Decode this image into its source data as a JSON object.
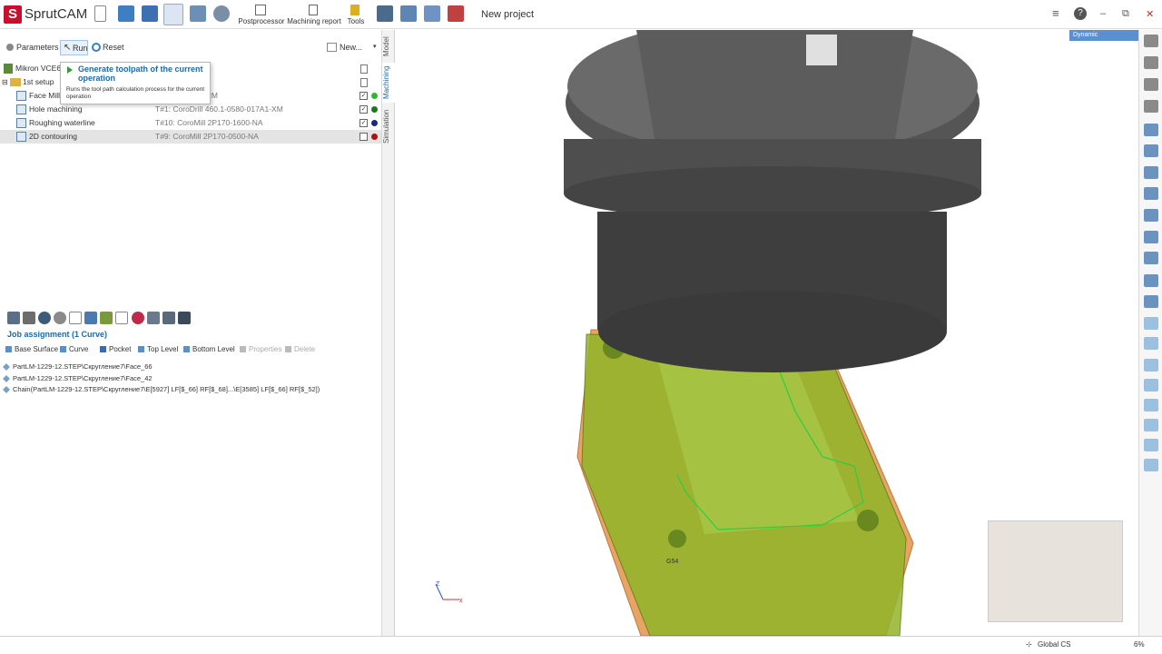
{
  "app": {
    "logo_letter": "S",
    "name": "SprutCAM",
    "project_title": "New project"
  },
  "toolbar": {
    "postprocessor_label": "Postprocessor",
    "machining_report_label": "Machining report",
    "tools_label": "Tools",
    "icons": [
      "new-file-icon",
      "open-icon",
      "save-icon",
      "toolpath-icon",
      "wrench-icon",
      "inspect-icon",
      "postprocessor-icon",
      "report-icon",
      "tools-icon",
      "view-icon",
      "curves-icon",
      "machine-icon",
      "clamp-icon"
    ]
  },
  "window_controls": {
    "menu": "≡",
    "help": "?",
    "minimize": "–",
    "restore": "⧉",
    "close": "✕"
  },
  "left_toolbar": {
    "parameters_label": "Parameters",
    "run_label": "Run",
    "reset_label": "Reset",
    "new_label": "New..."
  },
  "tree": {
    "machine_label": "Mikron VCE6",
    "setup_label": "1st setup",
    "operations": [
      {
        "name": "Face Mill",
        "tool": "R200028A32-12M",
        "checked": true,
        "status_color": "#2eb82e"
      },
      {
        "name": "Hole machining",
        "tool": "T#1: CoroDrill 460.1-0580-017A1-XM",
        "checked": true,
        "status_color": "#1a7a1a"
      },
      {
        "name": "Roughing waterline",
        "tool": "T#10: CoroMill 2P170-1600-NA",
        "checked": true,
        "status_color": "#1a2a7a"
      },
      {
        "name": "2D contouring",
        "tool": "T#9: CoroMill 2P170-0500-NA",
        "checked": false,
        "status_color": "#b01010"
      }
    ]
  },
  "tooltip": {
    "title": "Generate toolpath of the current operation",
    "body": "Runs the tool path calculation process for the current operation"
  },
  "job_assignment": {
    "header": "Job assignment",
    "count": "(1 Curve)",
    "tools": [
      "Base Surface",
      "Curve",
      "Pocket",
      "Top Level",
      "Bottom Level",
      "Properties",
      "Delete"
    ],
    "items": [
      "PartLM-1229-12.STEP\\Скругление7\\Face_66",
      "PartLM-1229-12.STEP\\Скругление7\\Face_42",
      "Chain(PartLM-1229-12.STEP\\Скругление7\\E[5927] LF[$_66] RF[$_68]...\\E[3585] LF[$_66] RF[$_52])"
    ]
  },
  "side_tabs": [
    "Model",
    "Machining",
    "Simulation"
  ],
  "viewport": {
    "view_mode": "Dynamic",
    "cs_label": "G54",
    "axis_z": "Z",
    "axis_x": "x"
  },
  "status": {
    "coordinate_system": "Global CS",
    "zoom": "6%"
  },
  "colors": {
    "accent": "#1f6aa5",
    "part_green": "#8fb320",
    "stock_orange": "#e8a060",
    "holder_grey": "#5a5a5a"
  }
}
